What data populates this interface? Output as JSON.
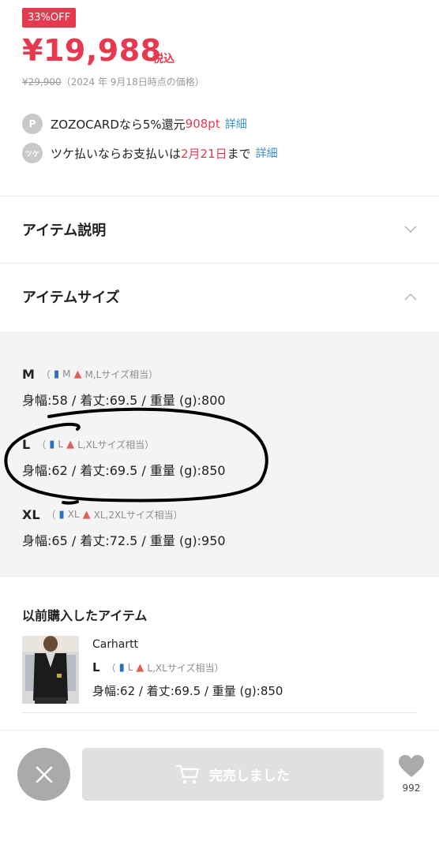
{
  "price": {
    "discount_badge": "33%OFF",
    "current": "¥19,988",
    "tax_label": "税込",
    "old_price": "¥29,900",
    "old_price_note": "（2024 年 9月18日時点の価格）"
  },
  "card_info": {
    "icon_letter": "P",
    "text_prefix": "ZOZOCARDなら5%還元 ",
    "points": "908pt",
    "link": "詳細"
  },
  "tsuke_info": {
    "icon_label": "ツケ",
    "text_prefix": "ツケ払いならお支払いは",
    "date": "2月21日",
    "text_suffix": "まで",
    "link": "詳細"
  },
  "sections": {
    "description_label": "アイテム説明",
    "size_label": "アイテムサイズ"
  },
  "sizes": [
    {
      "name": "M",
      "open": "（",
      "man": "M",
      "woman": "M,Lサイズ相当",
      "close": "）",
      "detail": "身幅:58 / 着丈:69.5 / 重量 (g):800"
    },
    {
      "name": "L",
      "open": "（",
      "man": "L",
      "woman": "L,XLサイズ相当",
      "close": "）",
      "detail": "身幅:62 / 着丈:69.5 / 重量 (g):850"
    },
    {
      "name": "XL",
      "open": "（",
      "man": "XL",
      "woman": "XL,2XLサイズ相当",
      "close": "）",
      "detail": "身幅:65 / 着丈:72.5 / 重量 (g):950"
    }
  ],
  "previous": {
    "title": "以前購入したアイテム",
    "brand": "Carhartt",
    "size_name": "L",
    "open": "（",
    "man": "L",
    "woman": "L,XLサイズ相当",
    "close": "）",
    "detail": "身幅:62 / 着丈:69.5 / 重量 (g):850"
  },
  "bottom": {
    "soldout_label": "完売しました",
    "fav_count": "992"
  },
  "colors": {
    "accent": "#e6394f",
    "link": "#3a8fd6",
    "man": "#2f6fc0",
    "woman": "#e06055"
  },
  "icons": {
    "man": "man-figure-icon",
    "woman": "woman-figure-icon",
    "cart": "cart-icon",
    "heart": "heart-icon",
    "close": "close-icon"
  }
}
